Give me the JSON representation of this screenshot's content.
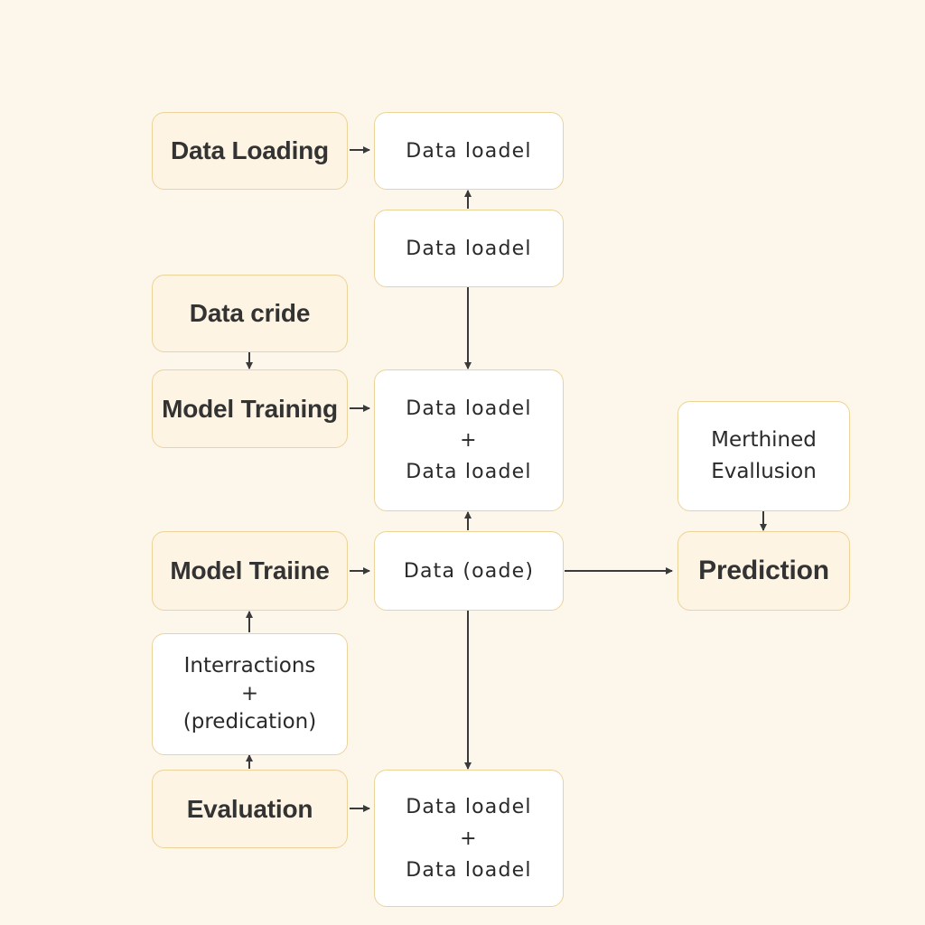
{
  "colors": {
    "background": "#fdf6ea",
    "box_border": "#ebd39a",
    "arrow": "#3a3a3a"
  },
  "nodes": {
    "data_loading": "Data Loading",
    "loader_top": "Data loadel",
    "loader_second": "Data loadel",
    "data_cride": "Data cride",
    "model_training": "Model Training",
    "loader_combo": {
      "line1": "Data loadel",
      "plus": "+",
      "line2": "Data loadel"
    },
    "model_traiine": "Model Traiine",
    "data_oade": "Data (oade)",
    "interactions": {
      "line1": "Interractions",
      "plus": "+",
      "line2": "(predication)"
    },
    "evaluation": "Evaluation",
    "loader_bottom": {
      "line1": "Data loadel",
      "plus": "+",
      "line2": "Data loadel"
    },
    "merthined": {
      "line1": "Merthined",
      "line2": "Evallusion"
    },
    "prediction": "Prediction"
  }
}
